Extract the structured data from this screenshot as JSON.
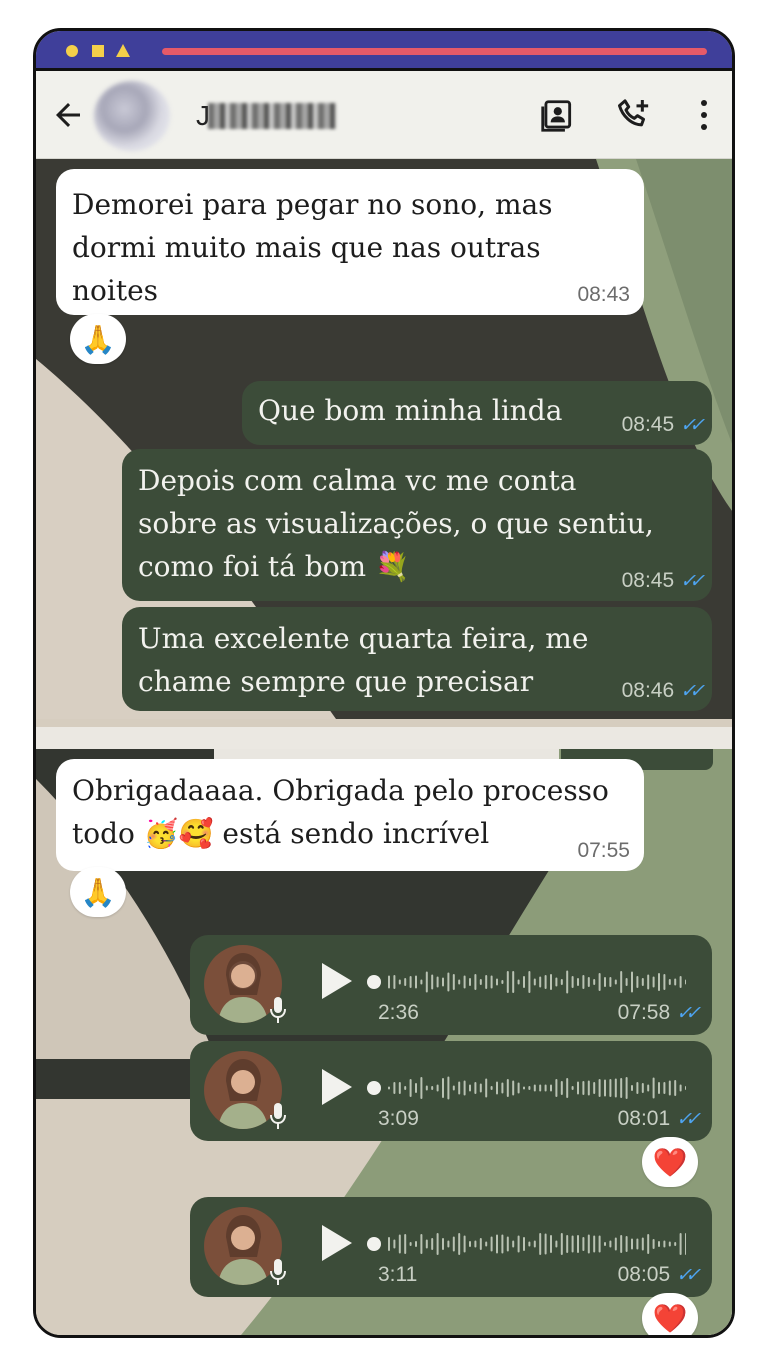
{
  "header": {
    "contact_name": "J",
    "icons": [
      "back-arrow-icon",
      "contact-card-icon",
      "add-call-icon",
      "more-vert-icon"
    ]
  },
  "messages": [
    {
      "dir": "in",
      "text": "Demorei para pegar no sono, mas\ndormi muito mais que nas outras\nnoites",
      "time": "08:43",
      "reaction": "🙏"
    },
    {
      "dir": "out",
      "text": "Que bom minha linda",
      "time": "08:45"
    },
    {
      "dir": "out",
      "text": "Depois com calma vc me conta\nsobre as visualizações, o que sentiu,\ncomo foi tá bom 💐",
      "time": "08:45"
    },
    {
      "dir": "out",
      "text": "Uma excelente quarta feira, me\nchame sempre que precisar",
      "time": "08:46"
    },
    {
      "dir": "in",
      "text": "Obrigadaaaa. Obrigada pelo processo\ntodo 🥳🥰 está sendo incrível",
      "time": "07:55",
      "reaction": "🙏"
    }
  ],
  "voice_notes": [
    {
      "duration": "2:36",
      "time": "07:58",
      "reaction": ""
    },
    {
      "duration": "3:09",
      "time": "08:01",
      "reaction": "❤️"
    },
    {
      "duration": "3:11",
      "time": "08:05",
      "reaction": "❤️"
    }
  ],
  "colors": {
    "titlebar": "#3f3f9a",
    "accent_bar": "#e65a68",
    "out_bubble": "#3c4c39",
    "in_bubble": "#ffffff",
    "read_ticks": "#4ea5f2"
  }
}
